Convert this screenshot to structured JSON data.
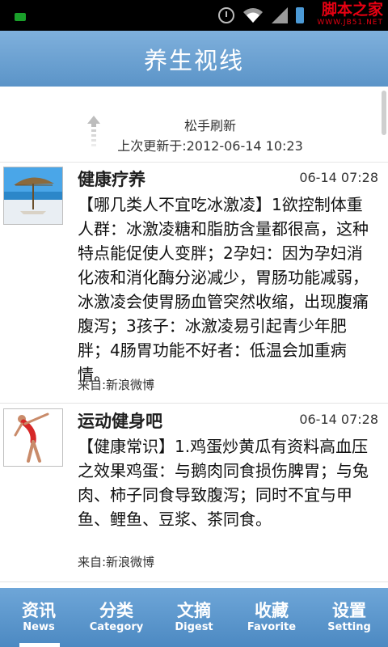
{
  "statusbar": {
    "icons": [
      "notification-icon",
      "alarm-icon",
      "wifi-icon",
      "signal-icon",
      "battery-icon"
    ],
    "watermark_main": "脚本之家",
    "watermark_sub": "WWW.JB51.NET"
  },
  "header": {
    "title": "养生视线"
  },
  "refresh": {
    "status": "松手刷新",
    "last_updated": "上次更新于:2012-06-14 10:23"
  },
  "feed": [
    {
      "name": "健康疗养",
      "time": "06-14 07:28",
      "text": "【哪几类人不宜吃冰激凌】1欲控制体重人群：冰激凌糖和脂肪含量都很高，这种特点能促使人变胖；2孕妇：因为孕妇消化液和消化酶分泌减少，胃肠功能减弱，冰激凌会使胃肠血管突然收缩，出现腹痛腹泻；3孩子：冰激凌易引起青少年肥胖；4肠胃功能不好者：低温会加重病情。",
      "source": "来自:新浪微博",
      "thumb": "beach-umbrella-image"
    },
    {
      "name": "运动健身吧",
      "time": "06-14 07:28",
      "text": "【健康常识】1.鸡蛋炒黄瓜有资料高血压之效果鸡蛋：与鹅肉同食损伤脾胃；与兔肉、柿子同食导致腹泻；同时不宜与甲鱼、鲤鱼、豆浆、茶同食。",
      "source": "来自:新浪微博",
      "thumb": "gymnast-image"
    }
  ],
  "tabs": [
    {
      "label": "资讯",
      "sublabel": "News",
      "active": true
    },
    {
      "label": "分类",
      "sublabel": "Category",
      "active": false
    },
    {
      "label": "文摘",
      "sublabel": "Digest",
      "active": false
    },
    {
      "label": "收藏",
      "sublabel": "Favorite",
      "active": false
    },
    {
      "label": "设置",
      "sublabel": "Setting",
      "active": false
    }
  ],
  "colors": {
    "titlebar": "#6aa3d6",
    "tabbar": "#5a95cc",
    "watermark": "#e60012"
  }
}
